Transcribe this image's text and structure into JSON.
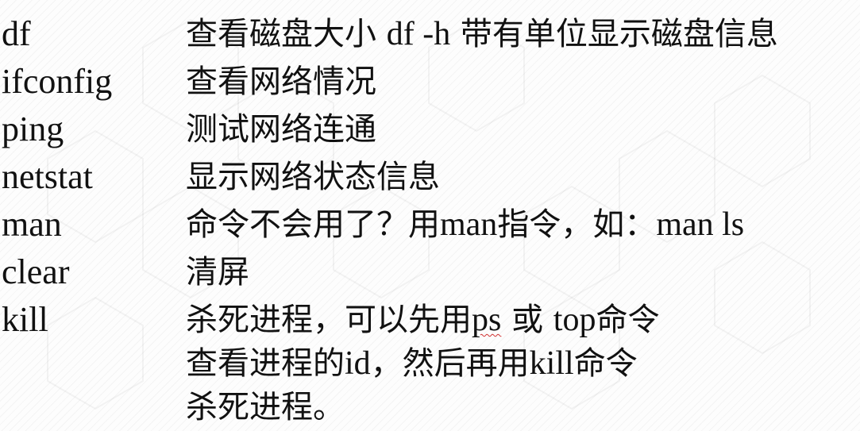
{
  "commands": [
    {
      "cmd": "df",
      "desc_a": "查看磁盘大小",
      "desc_b": "df -h",
      "desc_c": "带有单位显示磁盘信息"
    },
    {
      "cmd": "ifconfig",
      "desc": "查看网络情况"
    },
    {
      "cmd": "ping",
      "desc": "测试网络连通"
    },
    {
      "cmd": "netstat",
      "desc": "显示网络状态信息"
    },
    {
      "cmd": "man",
      "desc_a": "命令不会用了？用",
      "desc_b": "man",
      "desc_c": "指令，如：",
      "desc_d": "man ls"
    },
    {
      "cmd": "clear",
      "desc": "清屏"
    },
    {
      "cmd": "kill",
      "desc_a": "杀死进程，可以先用",
      "desc_b": "ps",
      "desc_c": " 或 ",
      "desc_d": "top",
      "desc_e": "命令"
    }
  ],
  "kill_continued": [
    {
      "a": "查看进程的",
      "b": "id",
      "c": "，然后再用",
      "d": "kill",
      "e": "命令"
    },
    {
      "a": "杀死进程。"
    }
  ]
}
